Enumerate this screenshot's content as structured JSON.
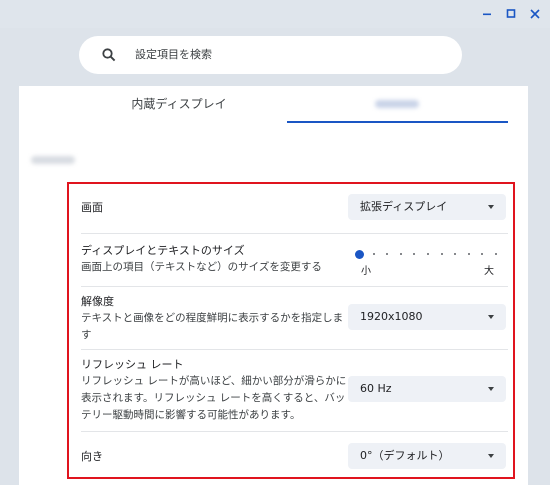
{
  "search": {
    "placeholder": "設定項目を検索"
  },
  "tabs": [
    {
      "label": "内蔵ディスプレイ"
    }
  ],
  "settings": {
    "screen": {
      "label": "画面",
      "value": "拡張ディスプレイ"
    },
    "size": {
      "label": "ディスプレイとテキストのサイズ",
      "desc": "画面上の項目（テキストなど）のサイズを変更する",
      "min_label": "小",
      "max_label": "大",
      "level": 0.0
    },
    "resolution": {
      "label": "解像度",
      "desc": "テキストと画像をどの程度鮮明に表示するかを指定します",
      "value": "1920x1080"
    },
    "refresh": {
      "label": "リフレッシュ レート",
      "desc": "リフレッシュ レートが高いほど、細かい部分が滑らかに表示されます。リフレッシュ レートを高くすると、バッテリー駆動時間に影響する可能性があります。",
      "value": "60 Hz"
    },
    "orientation": {
      "label": "向き",
      "value": "0°（デフォルト）"
    }
  },
  "colors": {
    "accent": "#1a56c4",
    "highlight": "#e0141e"
  }
}
